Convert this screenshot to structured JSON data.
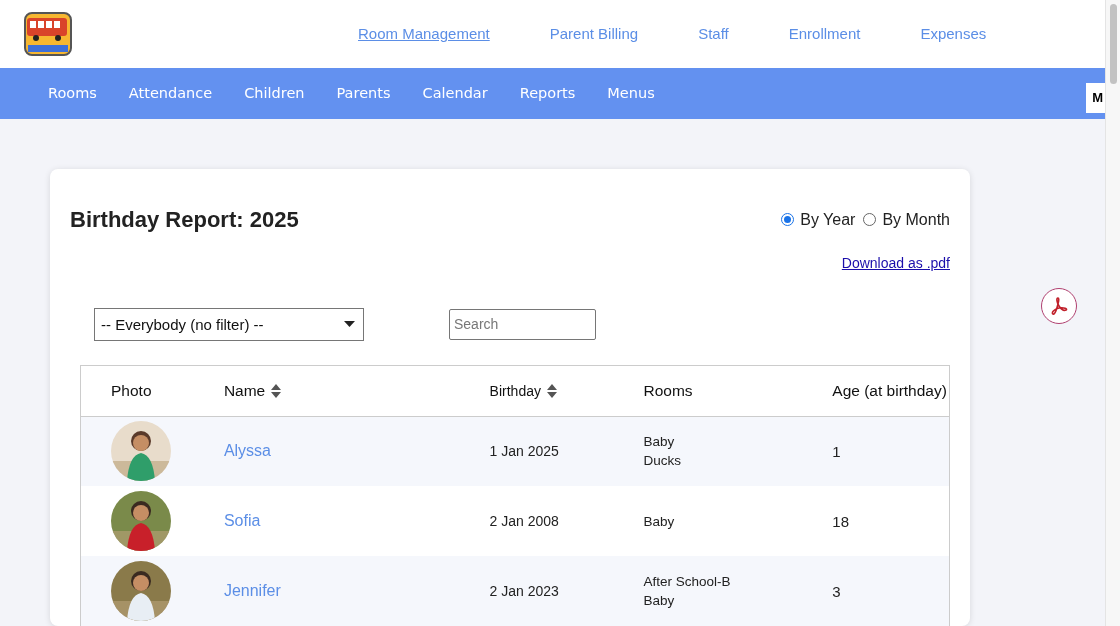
{
  "top_links": [
    {
      "label": "Room Management",
      "selected": true
    },
    {
      "label": "Parent Billing",
      "selected": false
    },
    {
      "label": "Staff",
      "selected": false
    },
    {
      "label": "Enrollment",
      "selected": false
    },
    {
      "label": "Expenses",
      "selected": false
    }
  ],
  "nav": [
    "Rooms",
    "Attendance",
    "Children",
    "Parents",
    "Calendar",
    "Reports",
    "Menus"
  ],
  "nav_cut_button": "M",
  "report": {
    "title": "Birthday Report: 2025",
    "period_options": [
      {
        "label": "By Year",
        "selected": true
      },
      {
        "label": "By Month",
        "selected": false
      }
    ],
    "download_link": "Download as .pdf",
    "filter": {
      "value": "-- Everybody (no filter) --"
    },
    "search": {
      "placeholder": "Search"
    },
    "table": {
      "columns": [
        {
          "label": "Photo",
          "sortable": false
        },
        {
          "label": "Name",
          "sortable": true
        },
        {
          "label": "Birthday",
          "sortable": true
        },
        {
          "label": "Rooms",
          "sortable": false
        },
        {
          "label": "Age (at birthday)",
          "sortable": false
        }
      ],
      "rows": [
        {
          "photo": {
            "kind": "picture"
          },
          "name": "Alyssa",
          "birthday": "1 Jan 2025",
          "rooms": [
            "Baby",
            "Ducks"
          ],
          "age": "1"
        },
        {
          "photo": {
            "kind": "picture"
          },
          "name": "Sofia",
          "birthday": "2 Jan 2008",
          "rooms": [
            "Baby"
          ],
          "age": "18"
        },
        {
          "photo": {
            "kind": "picture"
          },
          "name": "Jennifer",
          "birthday": "2 Jan 2023",
          "rooms": [
            "After School-B",
            "Baby"
          ],
          "age": "3"
        }
      ]
    }
  }
}
